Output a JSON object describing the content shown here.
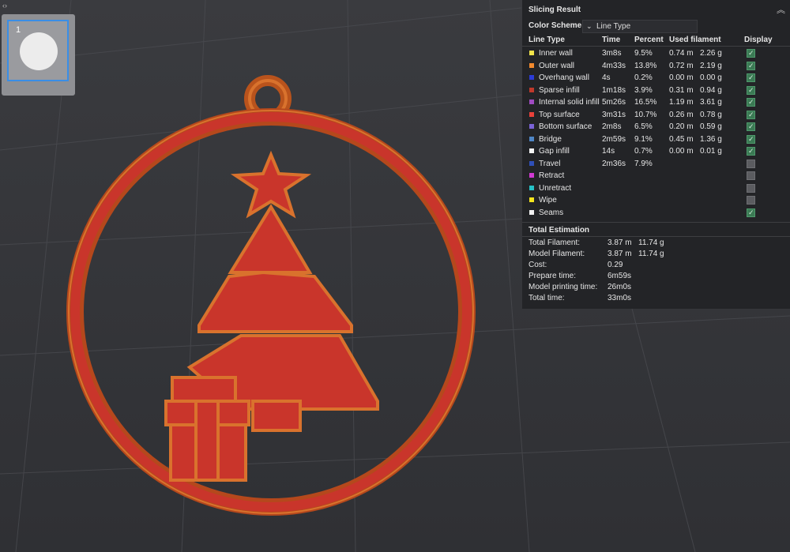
{
  "panel": {
    "title": "Slicing Result",
    "color_scheme_label": "Color Scheme",
    "color_scheme_value": "Line Type",
    "headers": {
      "line_type": "Line Type",
      "time": "Time",
      "percent": "Percent",
      "used_filament": "Used filament",
      "display": "Display"
    },
    "rows": [
      {
        "name": "Inner wall",
        "color": "#f2e44a",
        "time": "3m8s",
        "percent": "9.5%",
        "length": "0.74 m",
        "weight": "2.26 g",
        "checked": true
      },
      {
        "name": "Outer wall",
        "color": "#f28a2e",
        "time": "4m33s",
        "percent": "13.8%",
        "length": "0.72 m",
        "weight": "2.19 g",
        "checked": true
      },
      {
        "name": "Overhang wall",
        "color": "#2b3bd6",
        "time": "4s",
        "percent": "0.2%",
        "length": "0.00 m",
        "weight": "0.00 g",
        "checked": true
      },
      {
        "name": "Sparse infill",
        "color": "#c0392b",
        "time": "1m18s",
        "percent": "3.9%",
        "length": "0.31 m",
        "weight": "0.94 g",
        "checked": true
      },
      {
        "name": "Internal solid infill",
        "color": "#a04bc2",
        "time": "5m26s",
        "percent": "16.5%",
        "length": "1.19 m",
        "weight": "3.61 g",
        "checked": true
      },
      {
        "name": "Top surface",
        "color": "#e8413a",
        "time": "3m31s",
        "percent": "10.7%",
        "length": "0.26 m",
        "weight": "0.78 g",
        "checked": true
      },
      {
        "name": "Bottom surface",
        "color": "#7b63d8",
        "time": "2m8s",
        "percent": "6.5%",
        "length": "0.20 m",
        "weight": "0.59 g",
        "checked": true
      },
      {
        "name": "Bridge",
        "color": "#4f86c6",
        "time": "2m59s",
        "percent": "9.1%",
        "length": "0.45 m",
        "weight": "1.36 g",
        "checked": true
      },
      {
        "name": "Gap infill",
        "color": "#f4f4f4",
        "time": "14s",
        "percent": "0.7%",
        "length": "0.00 m",
        "weight": "0.01 g",
        "checked": true
      },
      {
        "name": "Travel",
        "color": "#2f4fb8",
        "time": "2m36s",
        "percent": "7.9%",
        "length": "",
        "weight": "",
        "checked": false
      },
      {
        "name": "Retract",
        "color": "#d13ad1",
        "time": "",
        "percent": "",
        "length": "",
        "weight": "",
        "checked": false
      },
      {
        "name": "Unretract",
        "color": "#26c1c6",
        "time": "",
        "percent": "",
        "length": "",
        "weight": "",
        "checked": false
      },
      {
        "name": "Wipe",
        "color": "#f5e51d",
        "time": "",
        "percent": "",
        "length": "",
        "weight": "",
        "checked": false
      },
      {
        "name": "Seams",
        "color": "#f0f0f0",
        "time": "",
        "percent": "",
        "length": "",
        "weight": "",
        "checked": true
      }
    ],
    "total_estimation": {
      "title": "Total Estimation",
      "items": [
        {
          "label": "Total Filament:",
          "v1": "3.87 m",
          "v2": "11.74 g"
        },
        {
          "label": "Model Filament:",
          "v1": "3.87 m",
          "v2": "11.74 g"
        },
        {
          "label": "Cost:",
          "v1": "0.29",
          "v2": ""
        },
        {
          "label": "Prepare time:",
          "v1": "6m59s",
          "v2": ""
        },
        {
          "label": "Model printing time:",
          "v1": "26m0s",
          "v2": ""
        },
        {
          "label": "Total time:",
          "v1": "33m0s",
          "v2": ""
        }
      ]
    }
  },
  "thumbnail": {
    "plate_number": "1"
  },
  "icons": {
    "collapse": "collapse-arrows-icon",
    "chevron": "chevron-down-icon",
    "panel_collapse": "double-chevron-up-icon"
  }
}
